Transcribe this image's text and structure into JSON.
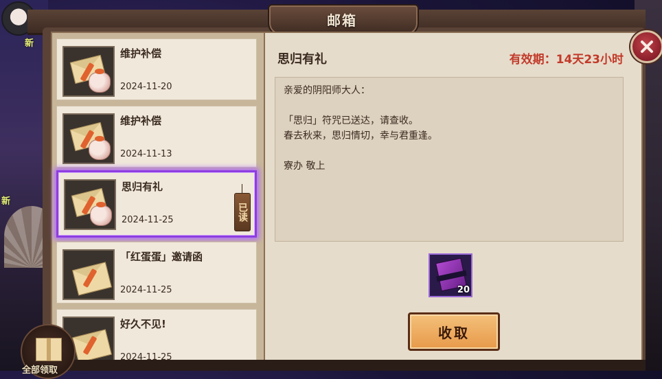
{
  "header": {
    "title": "邮箱"
  },
  "background": {
    "new_badge_1": "新",
    "new_badge_2": "新"
  },
  "mail_list": [
    {
      "title": "维护补偿",
      "date": "2024-11-20",
      "selected": false,
      "read": false
    },
    {
      "title": "维护补偿",
      "date": "2024-11-13",
      "selected": false,
      "read": false
    },
    {
      "title": "思归有礼",
      "date": "2024-11-25",
      "selected": true,
      "read": true,
      "read_label": "已读"
    },
    {
      "title": "「红蛋蛋」邀请函",
      "date": "2024-11-25",
      "selected": false,
      "read": false
    },
    {
      "title": "好久不见!",
      "date": "2024-11-25",
      "selected": false,
      "read": false
    }
  ],
  "detail": {
    "title": "思归有礼",
    "validity": "有效期：14天23小时",
    "body": {
      "greeting": "亲爱的阴阳师大人：",
      "line1": "「思归」符咒已送达，请查收。",
      "line2": "春去秋来，思归情切，幸与君重逢。",
      "signature": "寮办 敬上"
    },
    "attachment": {
      "icon": "purple-talisman-icon",
      "count": "20"
    },
    "claim_label": "收取"
  },
  "footer": {
    "claim_all_label": "全部领取"
  },
  "colors": {
    "accent_selected": "#8e3de0",
    "validity_red": "#c23a2a",
    "claim_button": "#e89a4a"
  }
}
